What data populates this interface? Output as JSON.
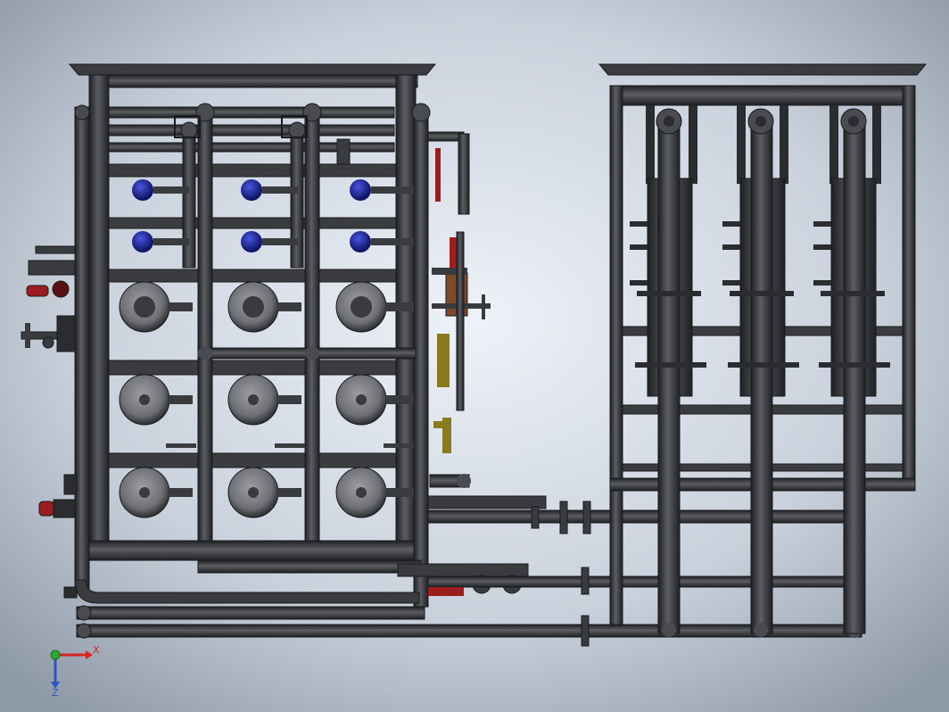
{
  "scene": {
    "background_center": "#e9eef5",
    "background_edge": "#9aa6b2",
    "steel_color": "#3a3b3f",
    "steel_highlight": "#6b6d72",
    "steel_dark": "#1f2023",
    "pump_face": "#7a7c80",
    "blue_valve": "#1f2a9a",
    "red_valve": "#9b1d1d",
    "brass_valve": "#8a7a1e"
  },
  "triad": {
    "x_label": "X",
    "z_label": "Z",
    "x_color": "#d42424",
    "z_color": "#2a55c8",
    "origin_color": "#2fa82f"
  }
}
